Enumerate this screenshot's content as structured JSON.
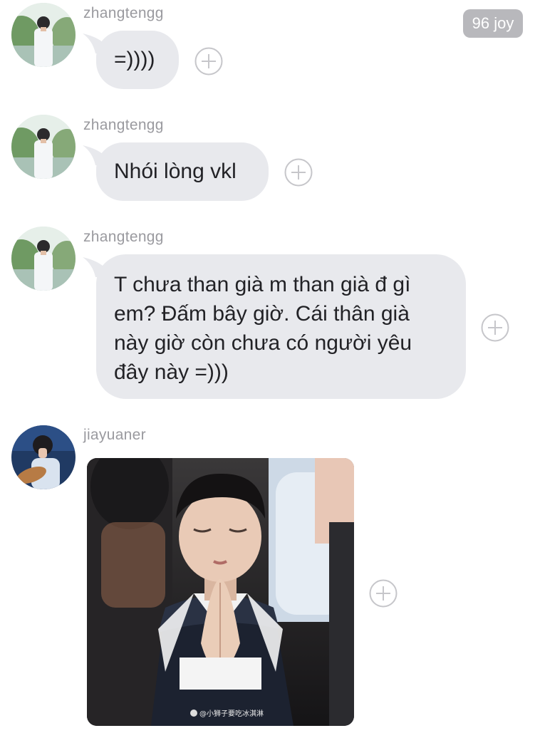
{
  "status_badge": {
    "text": "96 joy"
  },
  "messages": [
    {
      "username": "zhangtengg",
      "text": "=))))"
    },
    {
      "username": "zhangtengg",
      "text": "Nhói lòng vkl"
    },
    {
      "username": "zhangtengg",
      "text": "T chưa than già m than già đ gì em? Đấm bây giờ. Cái thân già này giờ còn chưa có người yêu đây này =)))"
    },
    {
      "username": "jiayuaner",
      "image_watermark": "@小狮子要吃冰淇淋"
    }
  ],
  "icons": {
    "react": "plus-circle-icon",
    "avatar": "user-avatar"
  },
  "colors": {
    "bubble": "#e8e9ed",
    "username": "#9a9a9f",
    "badge": "#b8b8bc"
  }
}
